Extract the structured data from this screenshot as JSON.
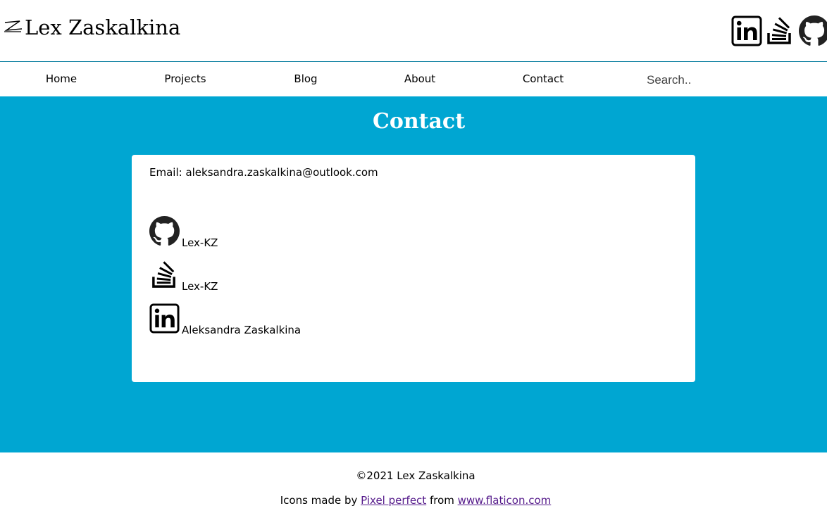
{
  "header": {
    "logo_text": "Lex Zaskalkina",
    "social_icons": [
      "linkedin-icon",
      "stackoverflow-icon",
      "github-icon"
    ]
  },
  "nav": {
    "items": [
      {
        "label": "Home"
      },
      {
        "label": "Projects"
      },
      {
        "label": "Blog"
      },
      {
        "label": "About"
      },
      {
        "label": "Contact"
      }
    ],
    "search_placeholder": "Search.."
  },
  "main": {
    "title": "Contact",
    "email": "Email: aleksandra.zaskalkina@outlook.com",
    "contacts": [
      {
        "icon": "github-icon",
        "label": "Lex-KZ"
      },
      {
        "icon": "stackoverflow-icon",
        "label": "Lex-KZ"
      },
      {
        "icon": "linkedin-icon",
        "label": "Aleksandra Zaskalkina"
      }
    ]
  },
  "footer": {
    "copyright": "©2021 Lex Zaskalkina",
    "credit_prefix": "Icons made by ",
    "credit_author": "Pixel perfect",
    "credit_middle": " from ",
    "credit_site": "www.flaticon.com"
  },
  "colors": {
    "accent": "#00a6d2",
    "divider": "#0a7fa0",
    "link": "#551a8b"
  }
}
